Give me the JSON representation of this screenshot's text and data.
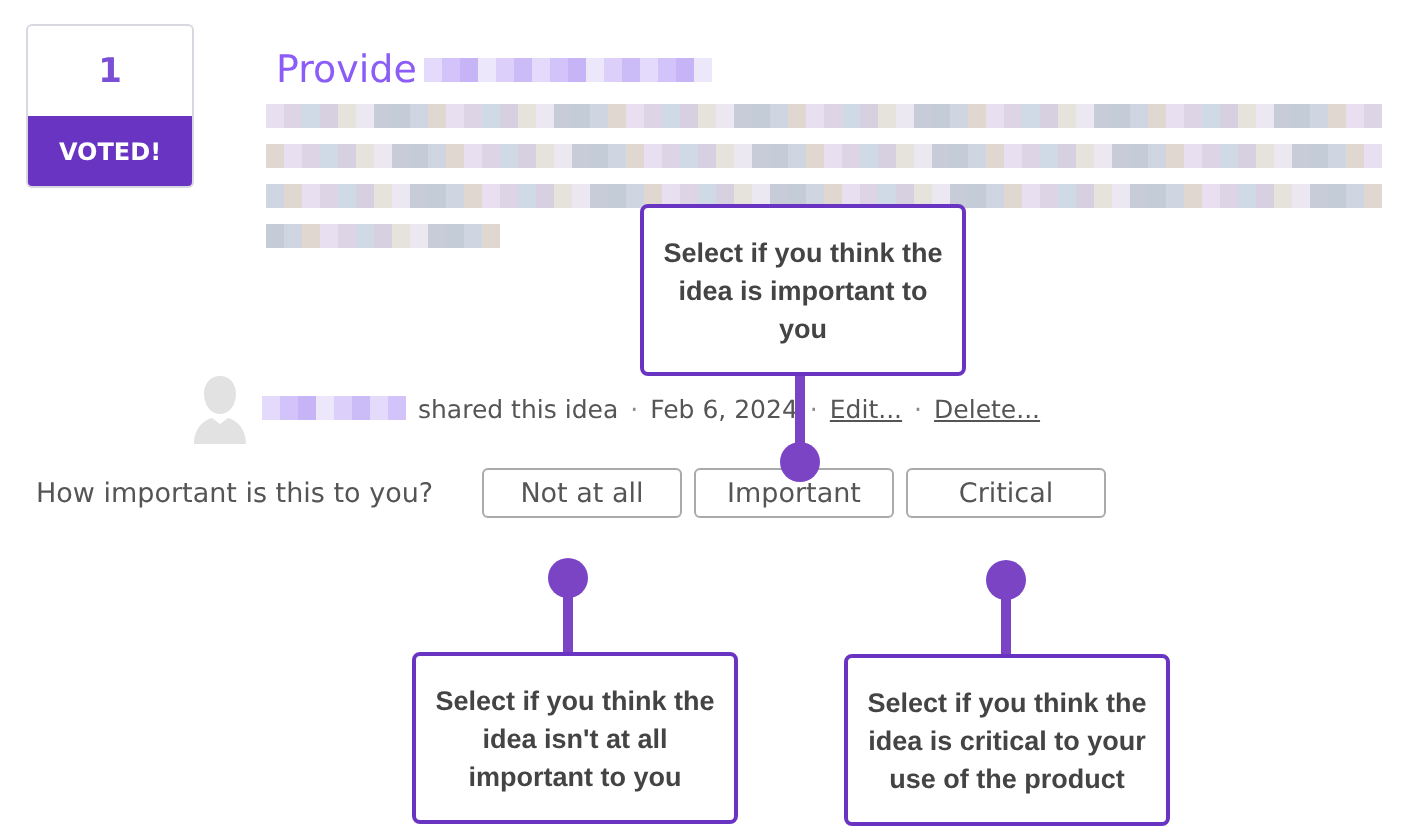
{
  "vote": {
    "count": "1",
    "label": "VOTED!"
  },
  "idea": {
    "title": "Provide"
  },
  "meta": {
    "shared": "shared this idea",
    "separator": "·",
    "date": "Feb 6, 2024",
    "links": [
      "Edit...",
      "Delete..."
    ]
  },
  "question": {
    "label": "How important is this to you?",
    "options": [
      {
        "label": "Not at all",
        "selected": false
      },
      {
        "label": "Important",
        "selected": false
      },
      {
        "label": "Critical",
        "selected": false
      }
    ]
  },
  "callouts": [
    {
      "text": "Select if you think the idea is important to you",
      "kind": "above"
    },
    {
      "text": "Select if you think the idea isn't at all important to you",
      "kind": "below"
    },
    {
      "text": "Select if you think the idea is critical to your use of the product",
      "kind": "below"
    }
  ]
}
